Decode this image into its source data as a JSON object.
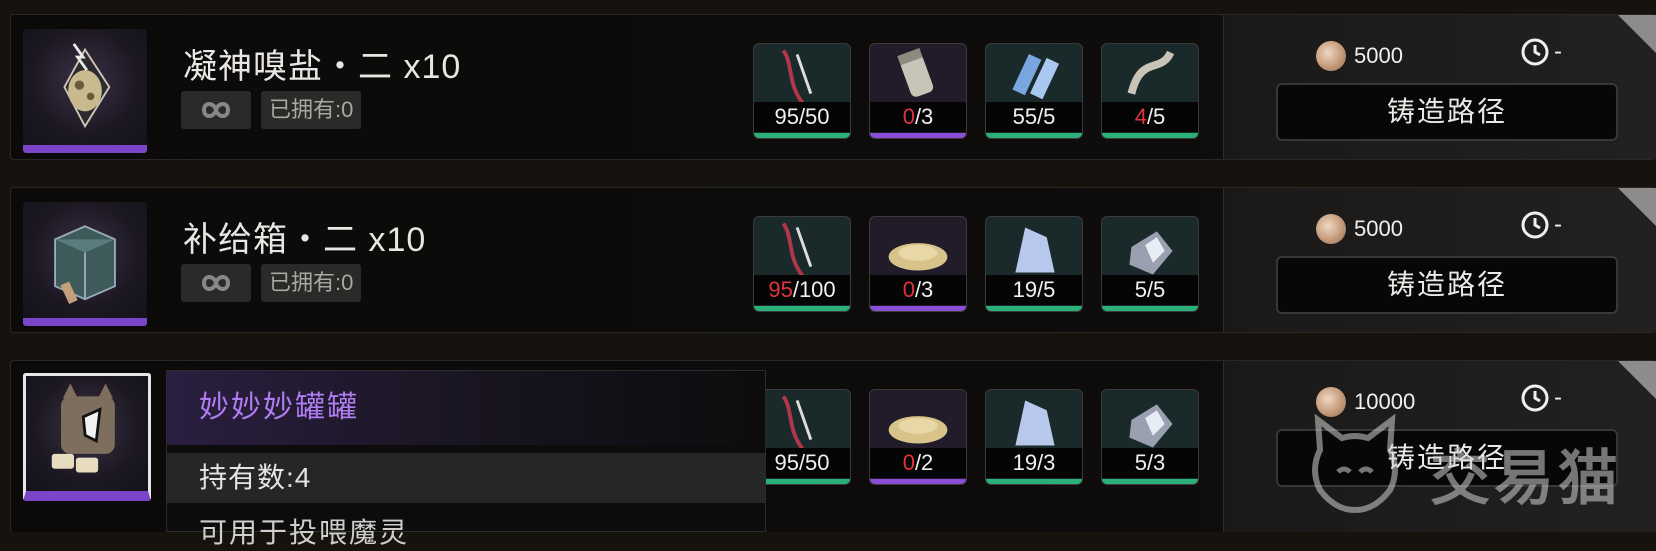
{
  "rows": [
    {
      "title": "凝神嗅盐・二 x10",
      "owned": "已拥有:0",
      "materials": [
        {
          "have": "95",
          "need": "/50",
          "short": false,
          "bar": "green"
        },
        {
          "have": "0",
          "need": "/3",
          "short": true,
          "bar": "purple"
        },
        {
          "have": "55",
          "need": "/5",
          "short": false,
          "bar": "green"
        },
        {
          "have": "4",
          "need": "/5",
          "short": true,
          "bar": "green"
        }
      ],
      "cost": "5000",
      "time": "-",
      "forge_label": "铸造路径"
    },
    {
      "title": "补给箱・二 x10",
      "owned": "已拥有:0",
      "materials": [
        {
          "have": "95",
          "need": "/100",
          "short": true,
          "bar": "green"
        },
        {
          "have": "0",
          "need": "/3",
          "short": true,
          "bar": "purple"
        },
        {
          "have": "19",
          "need": "/5",
          "short": false,
          "bar": "green"
        },
        {
          "have": "5",
          "need": "/5",
          "short": false,
          "bar": "green"
        }
      ],
      "cost": "5000",
      "time": "-",
      "forge_label": "铸造路径"
    },
    {
      "title": "",
      "owned": "",
      "materials": [
        {
          "have": "95",
          "need": "/50",
          "short": false,
          "bar": "green"
        },
        {
          "have": "0",
          "need": "/2",
          "short": true,
          "bar": "purple"
        },
        {
          "have": "19",
          "need": "/3",
          "short": false,
          "bar": "green"
        },
        {
          "have": "5",
          "need": "/3",
          "short": false,
          "bar": "green"
        }
      ],
      "cost": "10000",
      "time": "-",
      "forge_label": "铸造路径"
    }
  ],
  "tooltip": {
    "title": "妙妙妙罐罐",
    "own_count": "持有数:4",
    "desc": "可用于投喂魔灵"
  },
  "watermark": {
    "text": "交易猫"
  },
  "colors": {
    "accent_purple": "#7a45c8",
    "short_red": "#e0343c",
    "ok_green": "#2bb07a",
    "rarity_purple": "#8a4fd6"
  },
  "icons": [
    "infinity-icon",
    "coin-icon",
    "clock-icon",
    "pin-icon"
  ]
}
